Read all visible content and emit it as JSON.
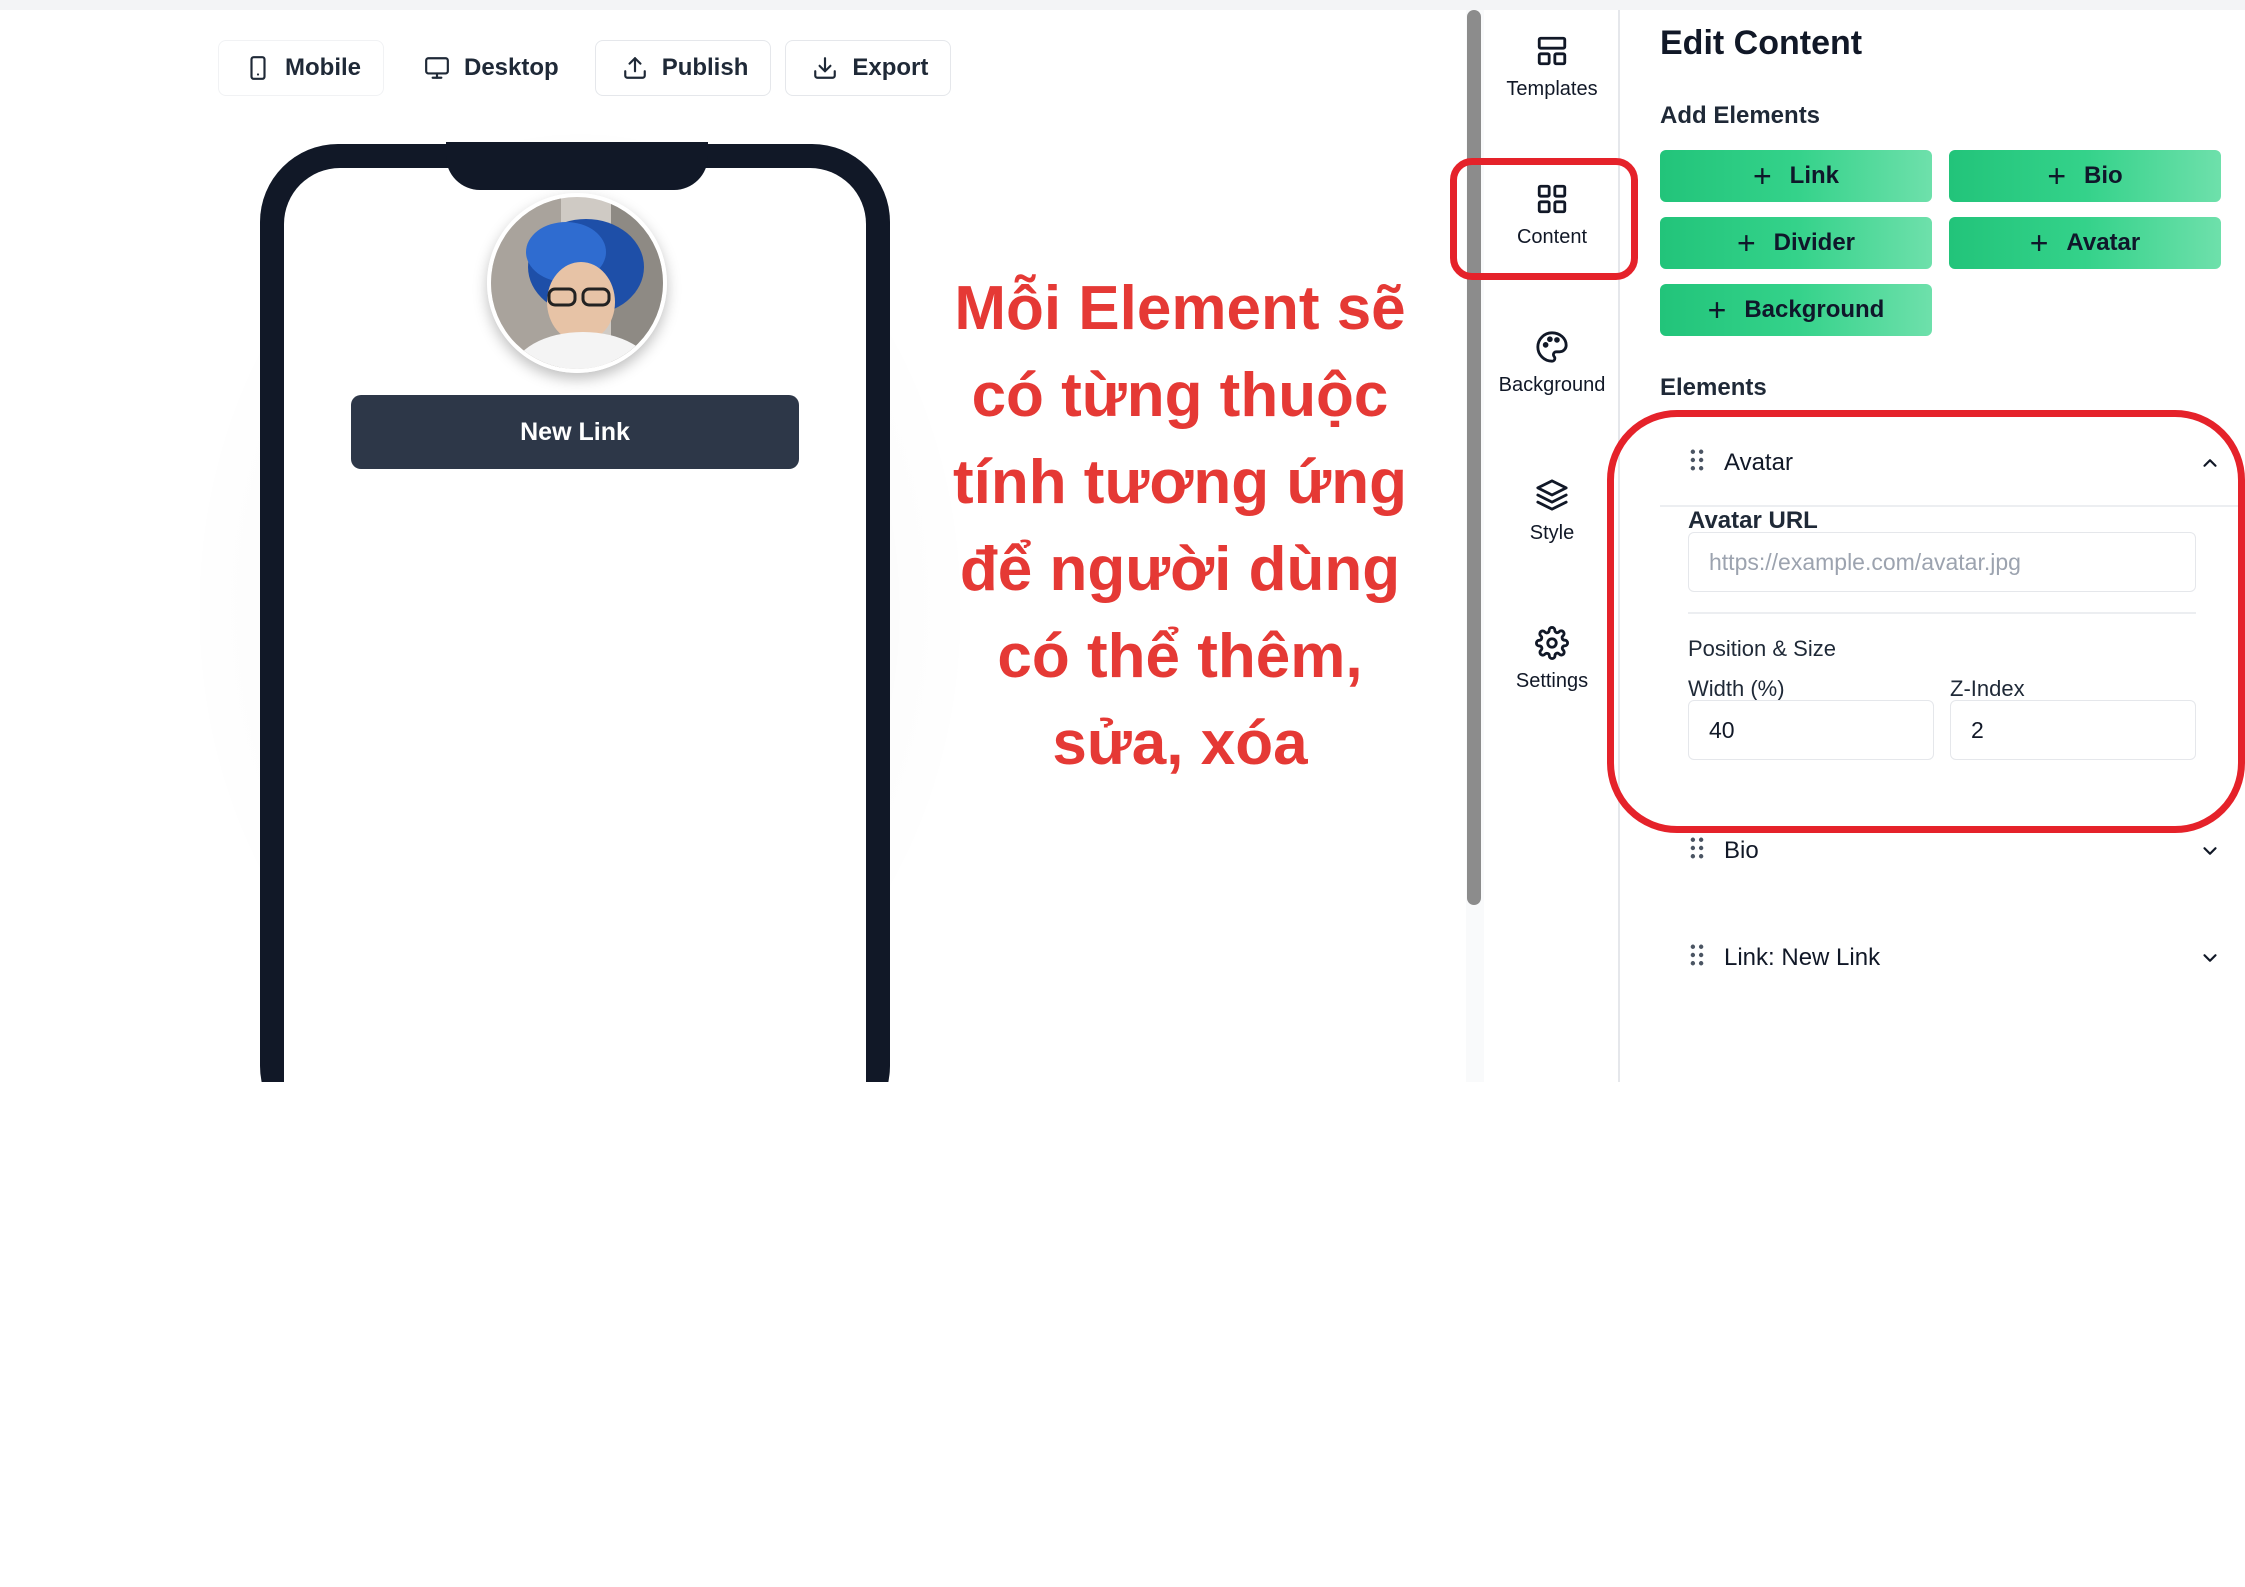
{
  "toolbar": {
    "mobile": "Mobile",
    "desktop": "Desktop",
    "publish": "Publish",
    "export": "Export"
  },
  "preview": {
    "link_button": "New Link"
  },
  "annotation": {
    "lines": [
      "Mỗi Element sẽ",
      "có từng thuộc",
      "tính tương ứng",
      "để người dùng",
      "có thể thêm,",
      "sửa, xóa"
    ],
    "color": "#e53935"
  },
  "rail": {
    "items": [
      {
        "label": "Templates",
        "icon": "layout-icon"
      },
      {
        "label": "Content",
        "icon": "grid-icon"
      },
      {
        "label": "Background",
        "icon": "palette-icon"
      },
      {
        "label": "Style",
        "icon": "layers-icon"
      },
      {
        "label": "Settings",
        "icon": "gear-icon"
      }
    ]
  },
  "panel": {
    "title": "Edit Content",
    "add_elements_label": "Add Elements",
    "add_buttons": [
      "Link",
      "Bio",
      "Divider",
      "Avatar",
      "Background"
    ],
    "elements_label": "Elements",
    "elements": [
      {
        "label": "Avatar",
        "expanded": true
      },
      {
        "label": "Bio",
        "expanded": false
      },
      {
        "label": "Link: New Link",
        "expanded": false
      }
    ],
    "avatar": {
      "url_label": "Avatar URL",
      "url_placeholder": "https://example.com/avatar.jpg",
      "position_size_label": "Position & Size",
      "width_label": "Width (%)",
      "width_value": "40",
      "zindex_label": "Z-Index",
      "zindex_value": "2"
    }
  },
  "colors": {
    "accent_green": "#22c47a",
    "phone_frame": "#111827",
    "link_button": "#2d3748",
    "highlight_red": "#e5222a"
  }
}
